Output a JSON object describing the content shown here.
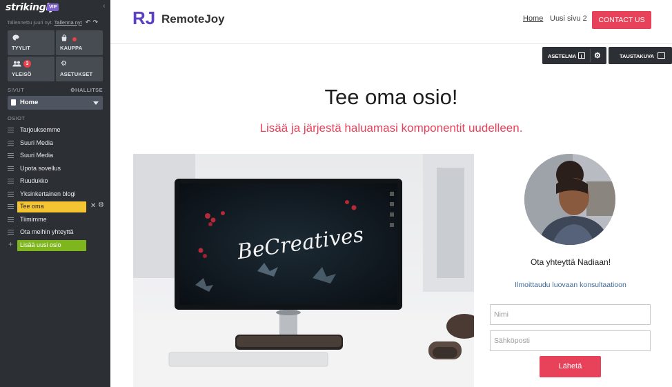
{
  "sidebar": {
    "brand": "strikingly",
    "badge": "VIP",
    "saved_text": "Tallennettu juuri nyt.",
    "save_link": "Tallenna nyt",
    "tiles": [
      {
        "label": "TYYLIT",
        "icon": "palette-icon"
      },
      {
        "label": "KAUPPA",
        "icon": "shopping-bag-icon"
      },
      {
        "label": "YLEISÖ",
        "icon": "people-icon",
        "badge": "3"
      },
      {
        "label": "ASETUKSET",
        "icon": "gear-icon"
      }
    ],
    "pages_header": "SIVUT",
    "manage_label": "HALLITSE",
    "current_page": "Home",
    "sections_header": "OSIOT",
    "sections": [
      {
        "label": "Tarjouksemme"
      },
      {
        "label": "Suuri Media"
      },
      {
        "label": "Suuri Media"
      },
      {
        "label": "Upota sovellus"
      },
      {
        "label": "Ruudukko"
      },
      {
        "label": "Yksinkertainen blogi"
      },
      {
        "label": "Tee oma"
      },
      {
        "label": "Tiimimme"
      },
      {
        "label": "Ota meihin yhteyttä"
      }
    ],
    "add_section": "Lisää uusi osio"
  },
  "header": {
    "logo_text": "RJ",
    "site_name": "RemoteJoy",
    "nav": [
      "Home",
      "Uusi sivu 2"
    ],
    "cta": "CONTACT US"
  },
  "toolbar": {
    "layout_label": "ASETELMA",
    "background_label": "TAUSTAKUVA"
  },
  "main": {
    "title": "Tee oma osio!",
    "subtitle": "Lisää ja järjestä haluamasi komponentit uudelleen.",
    "screen_text": "BeCreatives"
  },
  "contact": {
    "name": "Ota yhteyttä Nadiaan!",
    "link": "Ilmoittaudu luovaan konsultaatioon",
    "name_placeholder": "Nimi",
    "email_placeholder": "Sähköposti",
    "send": "Lähetä"
  },
  "colors": {
    "accent": "#e8415a",
    "highlight": "#f4c433",
    "add_green": "#7fb51d",
    "logo_purple": "#5b3fc4",
    "sidebar_bg": "#2c2f33"
  }
}
